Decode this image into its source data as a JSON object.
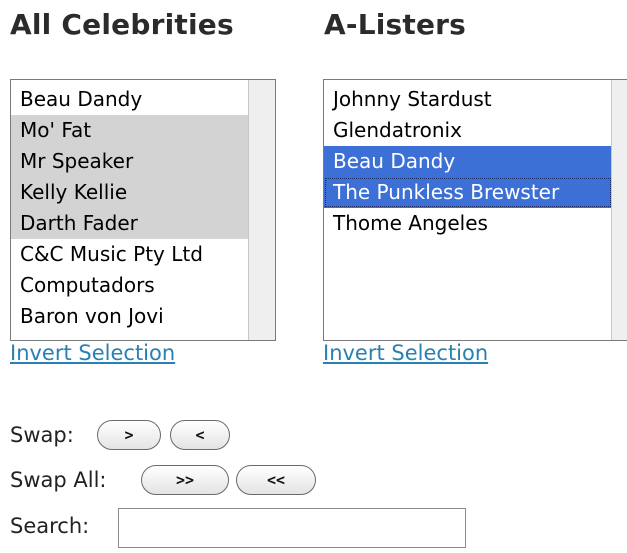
{
  "columns": {
    "all": {
      "title": "All Celebrities",
      "invert_label": "Invert Selection",
      "items": [
        {
          "label": "Beau Dandy",
          "state": "normal"
        },
        {
          "label": "Mo' Fat",
          "state": "gray"
        },
        {
          "label": "Mr Speaker",
          "state": "gray"
        },
        {
          "label": "Kelly Kellie",
          "state": "gray"
        },
        {
          "label": "Darth Fader",
          "state": "gray"
        },
        {
          "label": "C&C Music Pty Ltd",
          "state": "normal"
        },
        {
          "label": "Computadors",
          "state": "normal"
        },
        {
          "label": "Baron von Jovi",
          "state": "normal"
        }
      ]
    },
    "alisters": {
      "title": "A-Listers",
      "invert_label": "Invert Selection",
      "items": [
        {
          "label": "Johnny Stardust",
          "state": "normal"
        },
        {
          "label": "Glendatronix",
          "state": "normal"
        },
        {
          "label": "Beau Dandy",
          "state": "selected"
        },
        {
          "label": "The Punkless Brewster",
          "state": "selected-focused"
        },
        {
          "label": "Thome Angeles",
          "state": "normal"
        }
      ]
    }
  },
  "controls": {
    "swap_label": "Swap:",
    "swap_right": ">",
    "swap_left": "<",
    "swap_all_label": "Swap All:",
    "swap_all_right": ">>",
    "swap_all_left": "<<",
    "search_label": "Search:",
    "search_value": ""
  },
  "colors": {
    "selected_bg": "#3d70d6",
    "inactive_selected_bg": "#d3d3d3",
    "link": "#2a7fb3"
  }
}
